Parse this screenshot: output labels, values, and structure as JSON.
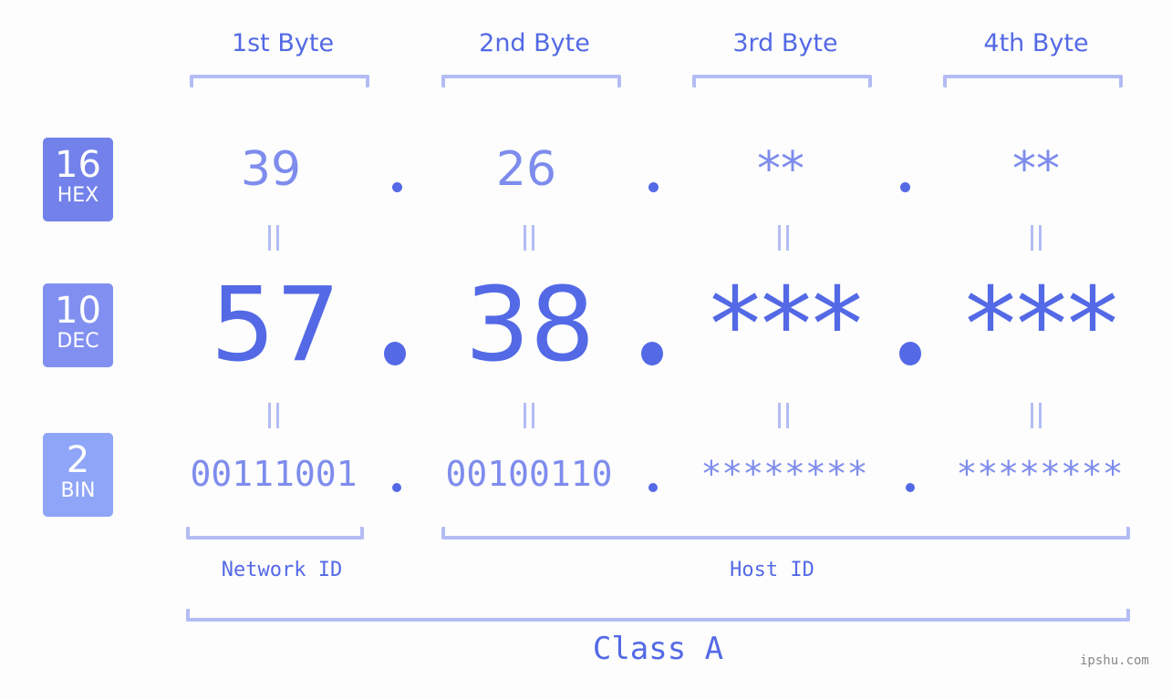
{
  "bytes": [
    {
      "title": "1st Byte",
      "hex": "39",
      "dec": "57",
      "bin": "00111001"
    },
    {
      "title": "2nd Byte",
      "hex": "26",
      "dec": "38",
      "bin": "00100110"
    },
    {
      "title": "3rd Byte",
      "hex": "**",
      "dec": "***",
      "bin": "********"
    },
    {
      "title": "4th Byte",
      "hex": "**",
      "dec": "***",
      "bin": "********"
    }
  ],
  "bases": [
    {
      "num": "16",
      "label": "HEX",
      "color": "#7381eb"
    },
    {
      "num": "10",
      "label": "DEC",
      "color": "#8190f0"
    },
    {
      "num": "2",
      "label": "BIN",
      "color": "#8fa5f8"
    }
  ],
  "segments": {
    "network": "Network ID",
    "host": "Host ID"
  },
  "class_label": "Class A",
  "watermark": "ipshu.com",
  "colors": {
    "primary": "#5469e6",
    "light": "#7e8ced",
    "bracket": "#b3bcf4"
  }
}
